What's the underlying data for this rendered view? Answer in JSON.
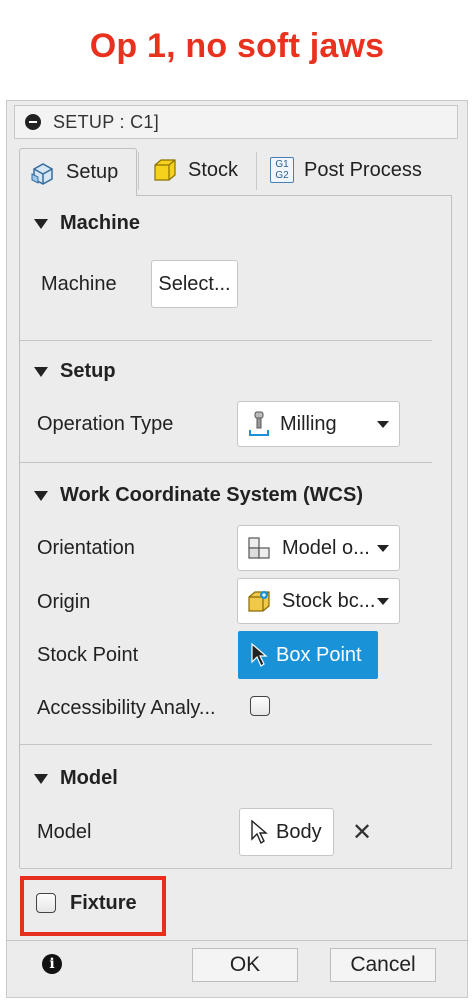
{
  "caption": "Op 1, no soft jaws",
  "dialog": {
    "title": "SETUP : C1]",
    "tabs": [
      {
        "label": "Setup"
      },
      {
        "label": "Stock"
      },
      {
        "label": "Post Process",
        "icon_text": "G1\nG2"
      }
    ],
    "machine": {
      "heading": "Machine",
      "label": "Machine",
      "button": "Select..."
    },
    "setup": {
      "heading": "Setup",
      "operation_type_label": "Operation Type",
      "operation_type_value": "Milling"
    },
    "wcs": {
      "heading": "Work Coordinate System (WCS)",
      "orientation_label": "Orientation",
      "orientation_value": "Model o...",
      "origin_label": "Origin",
      "origin_value": "Stock bc...",
      "stock_point_label": "Stock Point",
      "stock_point_value": "Box Point",
      "accessibility_label": "Accessibility Analy...",
      "accessibility_checked": false
    },
    "model": {
      "heading": "Model",
      "label": "Model",
      "value": "Body"
    },
    "fixture": {
      "label": "Fixture",
      "checked": false
    },
    "footer": {
      "ok": "OK",
      "cancel": "Cancel"
    }
  },
  "colors": {
    "caption_red": "#e8321e",
    "highlight_red": "#e5301f",
    "accent_blue": "#1a92d8"
  }
}
